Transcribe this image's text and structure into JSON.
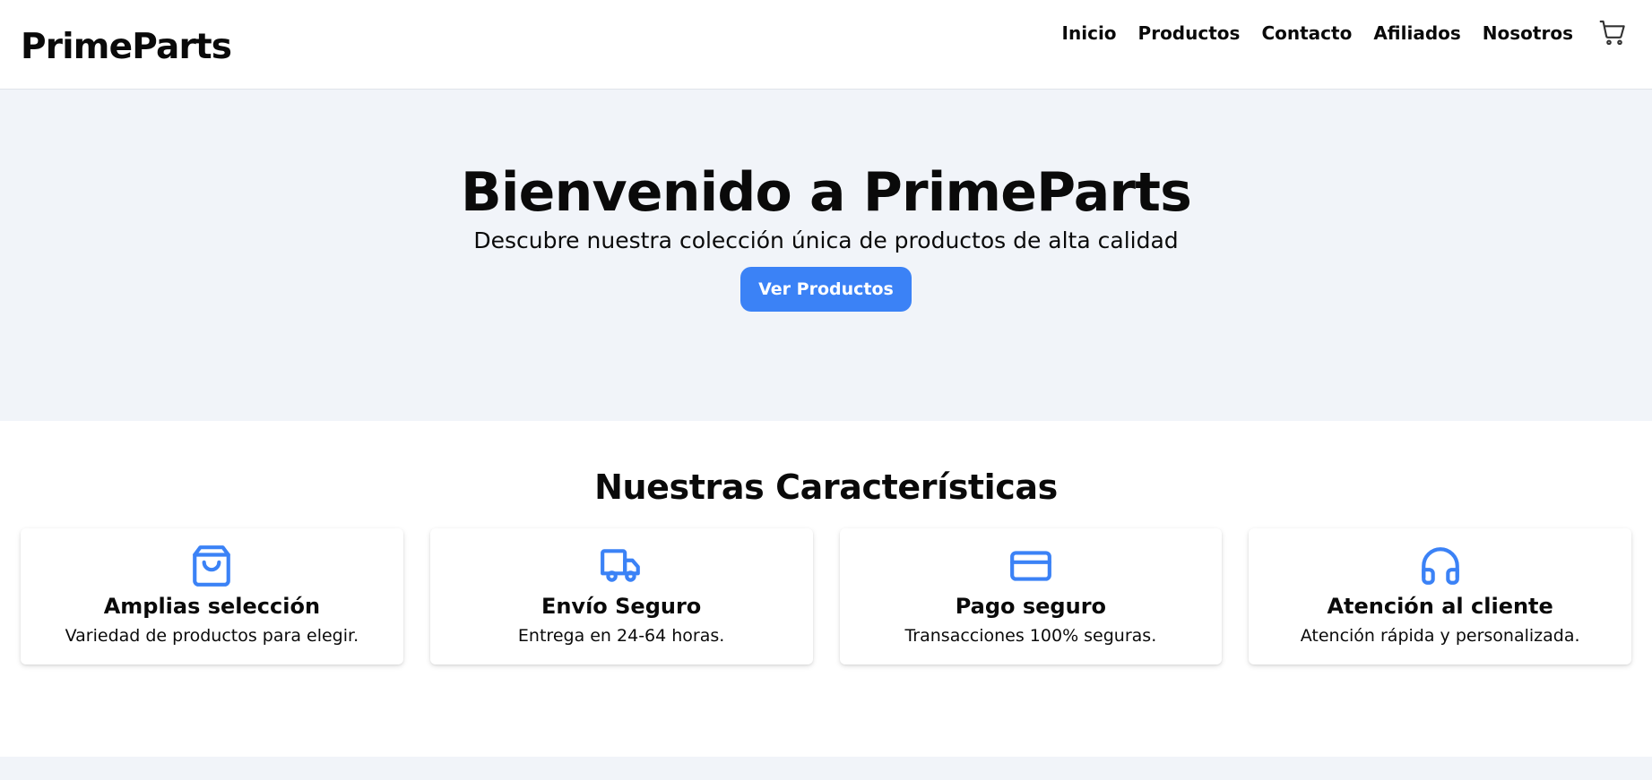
{
  "brand": "PrimeParts",
  "nav": [
    "Inicio",
    "Productos",
    "Contacto",
    "Afiliados",
    "Nosotros"
  ],
  "cart_icon": "shopping-cart-icon",
  "hero": {
    "title": "Bienvenido a PrimeParts",
    "subtitle": "Descubre nuestra colección única de productos de alta calidad",
    "button": "Ver Productos"
  },
  "features": {
    "title": "Nuestras Características",
    "items": [
      {
        "icon": "shopping-bag-icon",
        "title": "Amplias selección",
        "desc": "Variedad de productos para elegir."
      },
      {
        "icon": "truck-icon",
        "title": "Envío Seguro",
        "desc": "Entrega en 24-64 horas."
      },
      {
        "icon": "credit-card-icon",
        "title": "Pago seguro",
        "desc": "Transacciones 100% seguras."
      },
      {
        "icon": "headphones-icon",
        "title": "Atención al cliente",
        "desc": "Atención rápida y personalizada."
      }
    ]
  },
  "colors": {
    "accent": "#3b82f6",
    "hero_bg": "#f1f4f9",
    "text": "#0a0a0a"
  }
}
